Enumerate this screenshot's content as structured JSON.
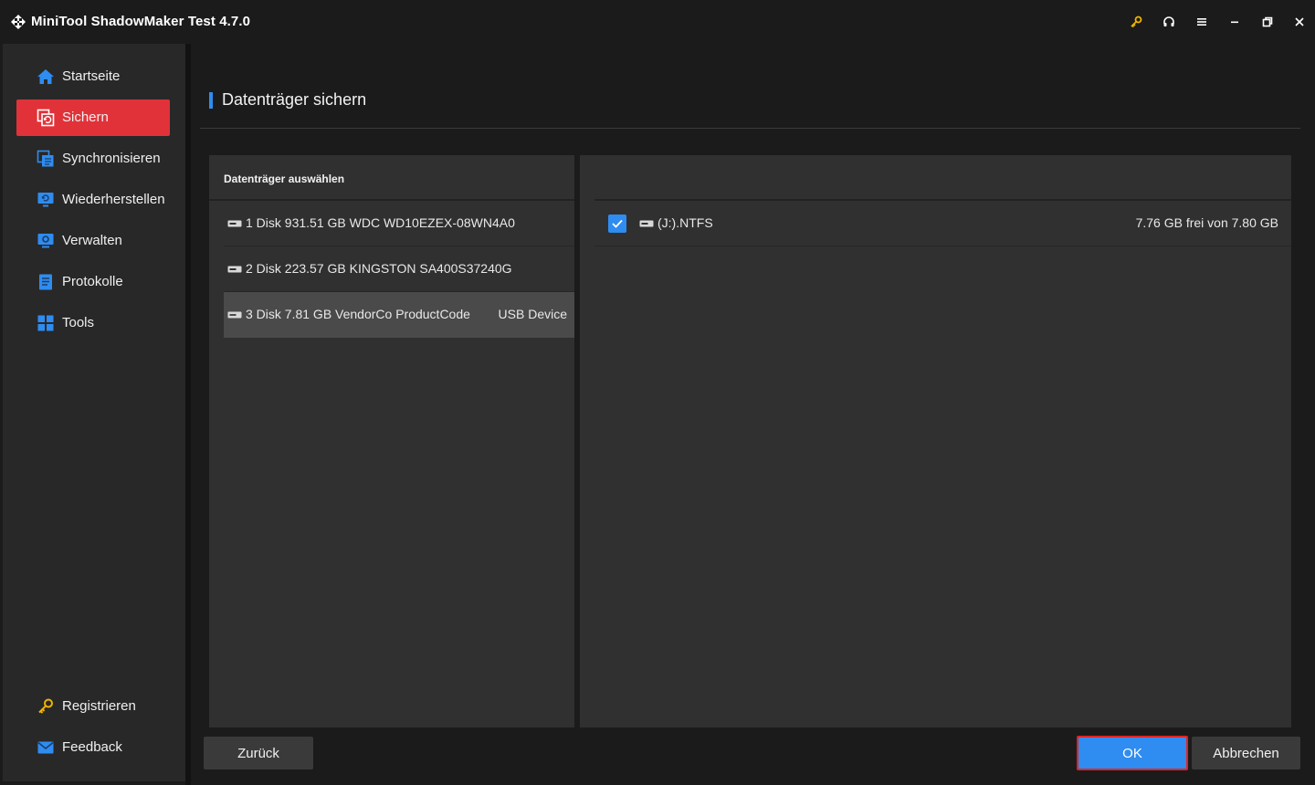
{
  "window": {
    "title": "MiniTool ShadowMaker Test 4.7.0",
    "controls": [
      "key-icon",
      "headset-icon",
      "menu-icon",
      "minimize-icon",
      "restore-icon",
      "close-icon"
    ]
  },
  "sidebar": {
    "items": [
      {
        "label": "Startseite",
        "icon": "home-icon",
        "active": false
      },
      {
        "label": "Sichern",
        "icon": "backup-icon",
        "active": true
      },
      {
        "label": "Synchronisieren",
        "icon": "sync-icon",
        "active": false
      },
      {
        "label": "Wiederherstellen",
        "icon": "restore-icon",
        "active": false
      },
      {
        "label": "Verwalten",
        "icon": "manage-icon",
        "active": false
      },
      {
        "label": "Protokolle",
        "icon": "log-icon",
        "active": false
      },
      {
        "label": "Tools",
        "icon": "tools-icon",
        "active": false
      }
    ],
    "bottom_items": [
      {
        "label": "Registrieren",
        "icon": "key-icon"
      },
      {
        "label": "Feedback",
        "icon": "mail-icon"
      }
    ]
  },
  "main": {
    "title": "Datenträger sichern",
    "left_panel": {
      "header": "Datenträger auswählen",
      "disks": [
        {
          "label": "1 Disk 931.51 GB WDC WD10EZEX-08WN4A0",
          "extra": "",
          "selected": false
        },
        {
          "label": "2 Disk 223.57 GB KINGSTON SA400S37240G",
          "extra": "",
          "selected": false
        },
        {
          "label": "3 Disk 7.81 GB VendorCo ProductCode",
          "extra": "USB Device",
          "selected": true
        }
      ]
    },
    "right_panel": {
      "partitions": [
        {
          "label": "(J:).NTFS",
          "size": "7.76 GB frei von 7.80 GB",
          "checked": true
        }
      ]
    },
    "buttons": {
      "back": "Zurück",
      "ok": "OK",
      "cancel": "Abbrechen"
    }
  },
  "colors": {
    "accent": "#2f8cf0",
    "active_nav": "#e13239",
    "highlight_border": "#e02424"
  }
}
